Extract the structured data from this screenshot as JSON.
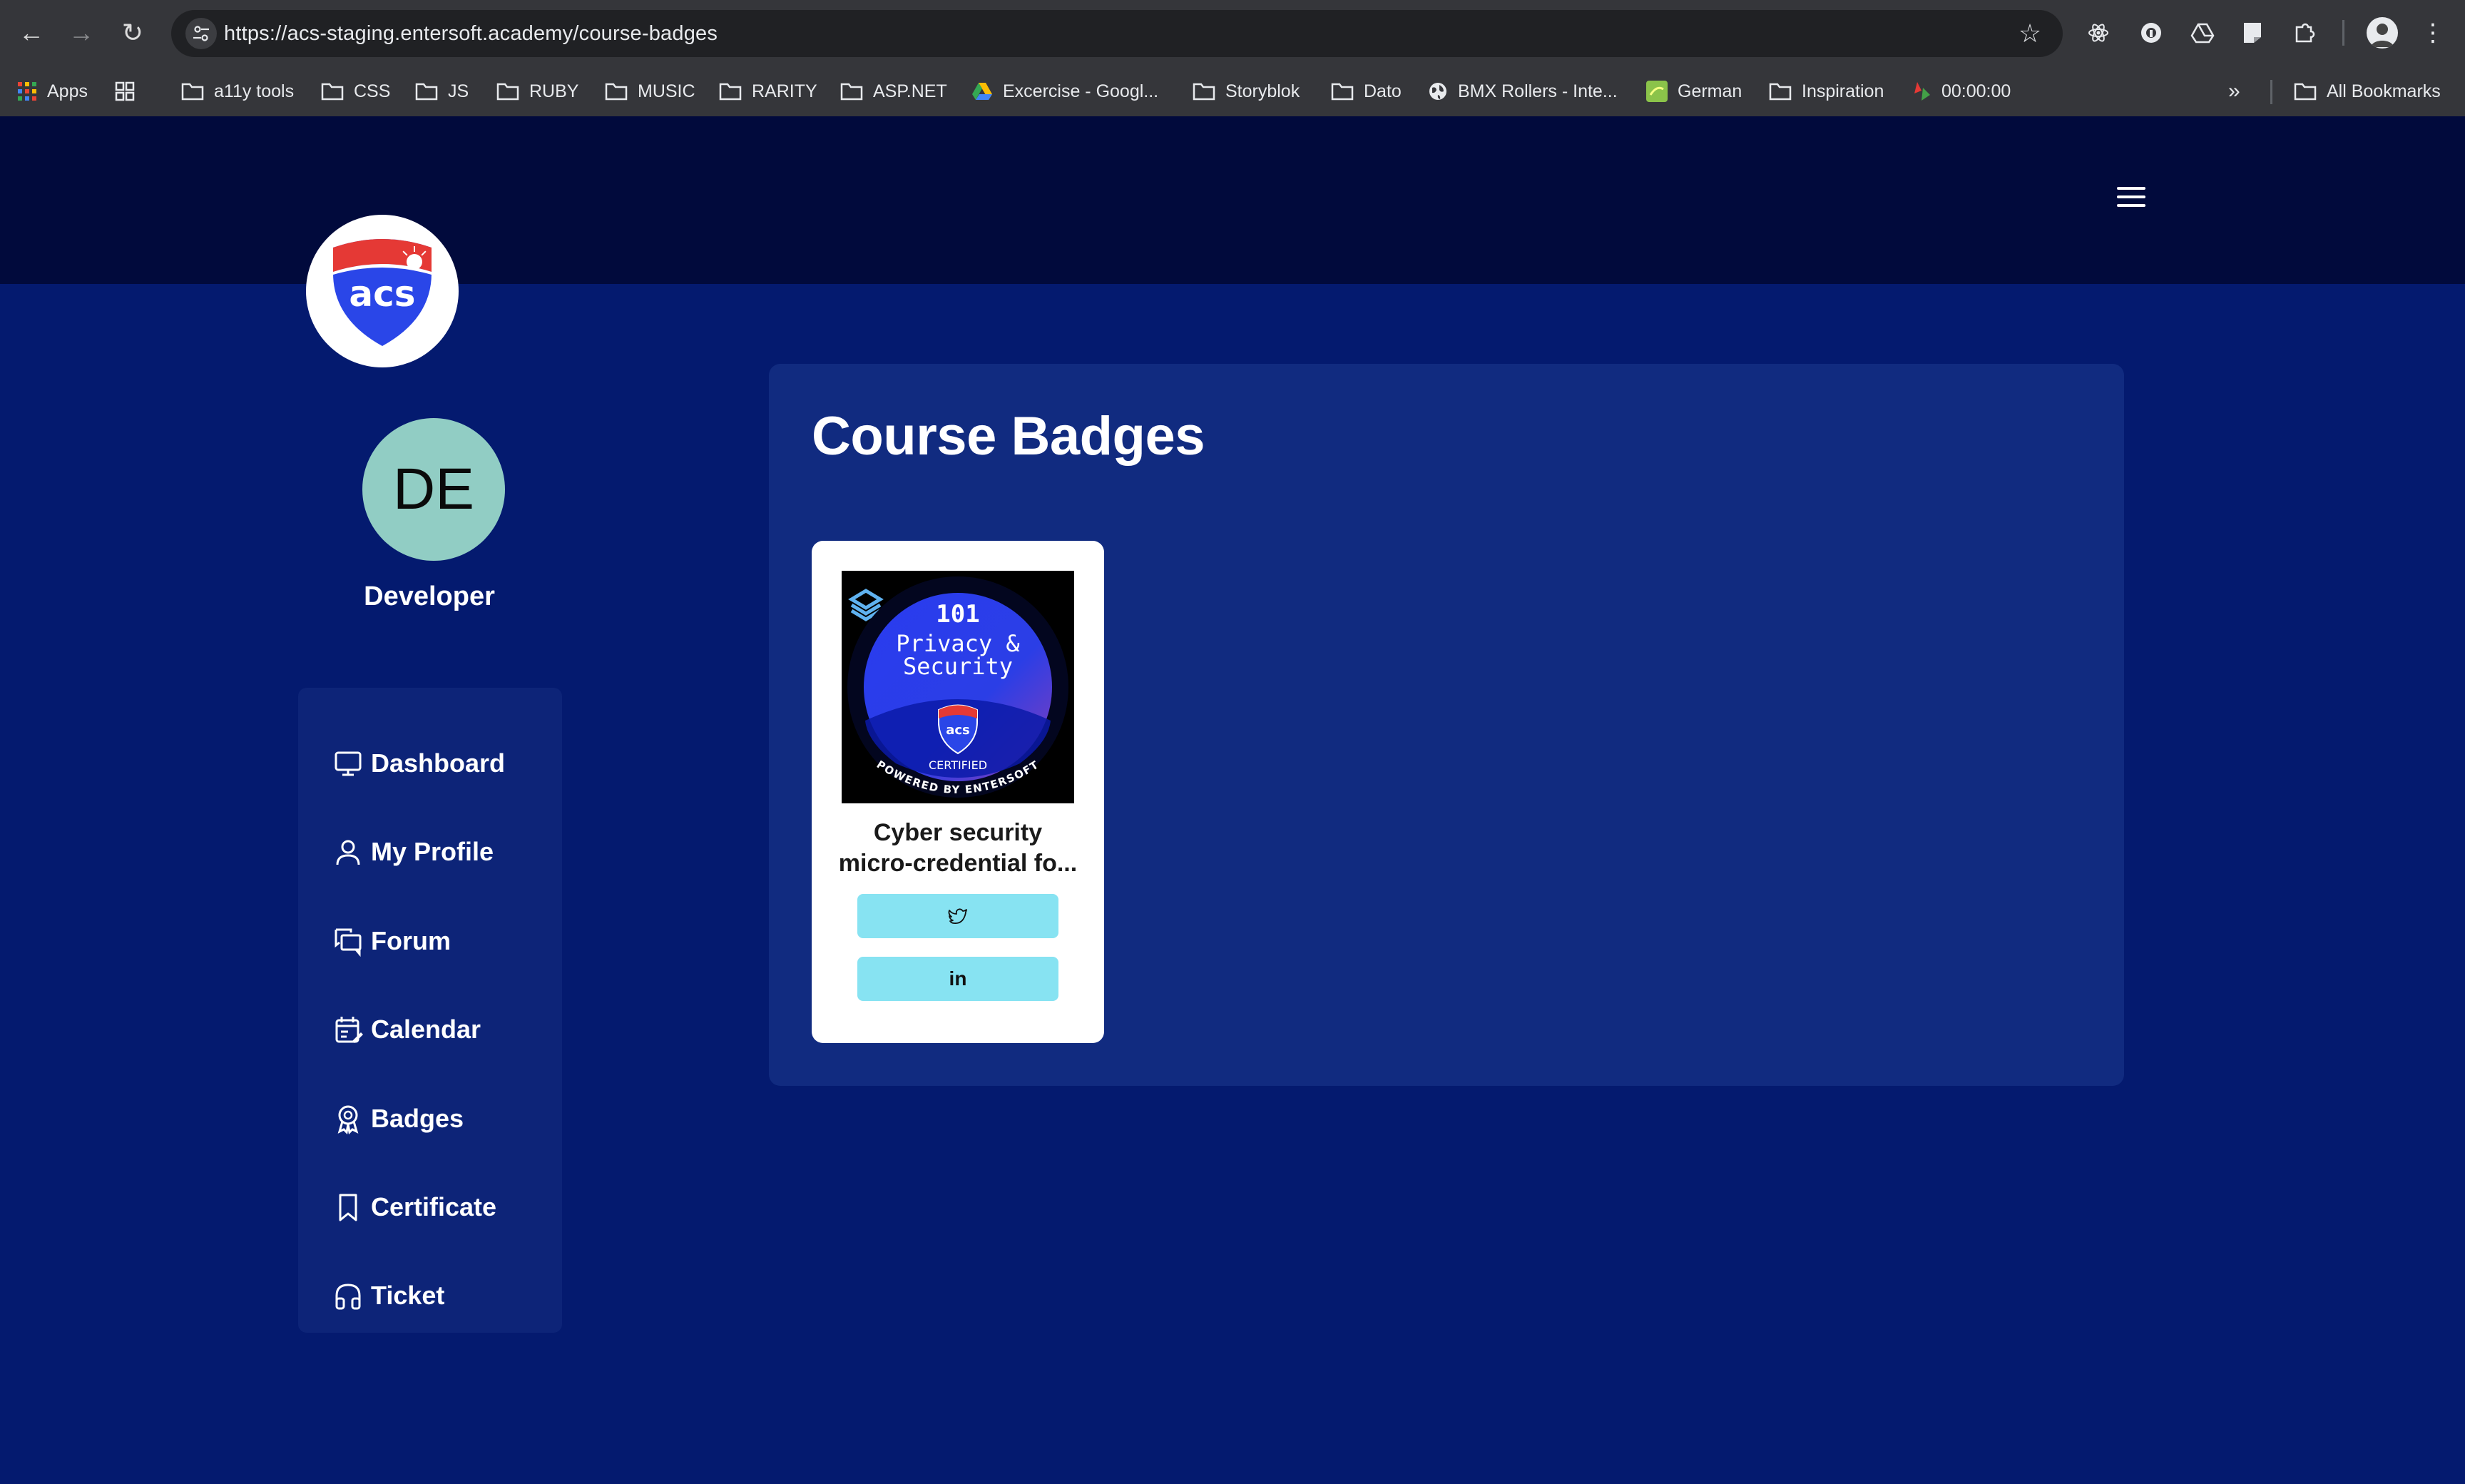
{
  "browser": {
    "url": "https://acs-staging.entersoft.academy/course-badges",
    "bookmarks": [
      {
        "label": "Apps",
        "icon": "apps-grid-icon"
      },
      {
        "label": "a11y tools",
        "icon": "folder-icon"
      },
      {
        "label": "CSS",
        "icon": "folder-icon"
      },
      {
        "label": "JS",
        "icon": "folder-icon"
      },
      {
        "label": "RUBY",
        "icon": "folder-icon"
      },
      {
        "label": "MUSIC",
        "icon": "folder-icon"
      },
      {
        "label": "RARITY",
        "icon": "folder-icon"
      },
      {
        "label": "ASP.NET",
        "icon": "folder-icon"
      },
      {
        "label": "Excercise - Googl...",
        "icon": "drive-icon"
      },
      {
        "label": "Storyblok",
        "icon": "folder-icon"
      },
      {
        "label": "Dato",
        "icon": "folder-icon"
      },
      {
        "label": "BMX Rollers - Inte...",
        "icon": "globe-icon"
      },
      {
        "label": "German",
        "icon": "site-icon"
      },
      {
        "label": "Inspiration",
        "icon": "folder-icon"
      },
      {
        "label": "00:00:00",
        "icon": "timer-icon"
      }
    ],
    "all_bookmarks": "All Bookmarks"
  },
  "logo": {
    "text": "acs"
  },
  "user": {
    "initials": "DE",
    "name": "Developer"
  },
  "nav": [
    {
      "label": "Dashboard",
      "icon": "monitor-icon"
    },
    {
      "label": "My Profile",
      "icon": "user-icon"
    },
    {
      "label": "Forum",
      "icon": "forum-icon"
    },
    {
      "label": "Calendar",
      "icon": "calendar-icon"
    },
    {
      "label": "Badges",
      "icon": "award-icon"
    },
    {
      "label": "Certificate",
      "icon": "bookmark-icon"
    },
    {
      "label": "Ticket",
      "icon": "headphones-icon"
    }
  ],
  "page": {
    "title": "Course Badges"
  },
  "badge_card": {
    "title_line1": "Cyber security",
    "title_line2": "micro-credential fo...",
    "image": {
      "number": "101",
      "line1": "Privacy &",
      "line2": "Security",
      "logo": "acs",
      "certified": "CERTIFIED",
      "powered": "POWERED BY ENTERSOFT"
    },
    "linkedin_label": "in"
  },
  "colors": {
    "page_bg": "#041a6f",
    "top_bar": "#010a3c",
    "panel": "#112b80",
    "sidebar": "#0d2478",
    "avatar": "#91cdc4",
    "share_button": "#87e3f2"
  }
}
